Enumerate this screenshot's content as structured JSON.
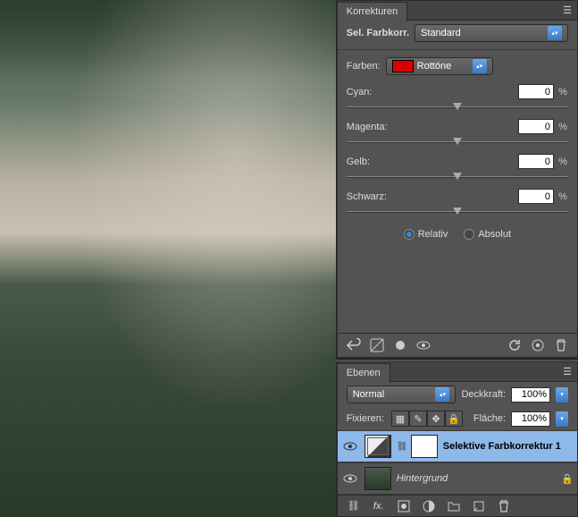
{
  "corrections": {
    "tab": "Korrekturen",
    "preset_label": "Sel. Farbkorr.",
    "preset_value": "Standard",
    "colors_label": "Farben:",
    "colors_value": "Rottöne",
    "sliders": [
      {
        "name": "Cyan:",
        "value": "0"
      },
      {
        "name": "Magenta:",
        "value": "0"
      },
      {
        "name": "Gelb:",
        "value": "0"
      },
      {
        "name": "Schwarz:",
        "value": "0"
      }
    ],
    "pct": "%",
    "mode": {
      "relative": "Relativ",
      "absolute": "Absolut",
      "selected": "relative"
    }
  },
  "layers": {
    "tab": "Ebenen",
    "blend_mode": "Normal",
    "opacity_label": "Deckkraft:",
    "opacity_value": "100%",
    "lock_label": "Fixieren:",
    "fill_label": "Fläche:",
    "fill_value": "100%",
    "items": [
      {
        "name": "Selektive Farbkorrektur 1",
        "selected": true,
        "type": "adjustment"
      },
      {
        "name": "Hintergrund",
        "selected": false,
        "type": "background",
        "locked": true
      }
    ]
  }
}
